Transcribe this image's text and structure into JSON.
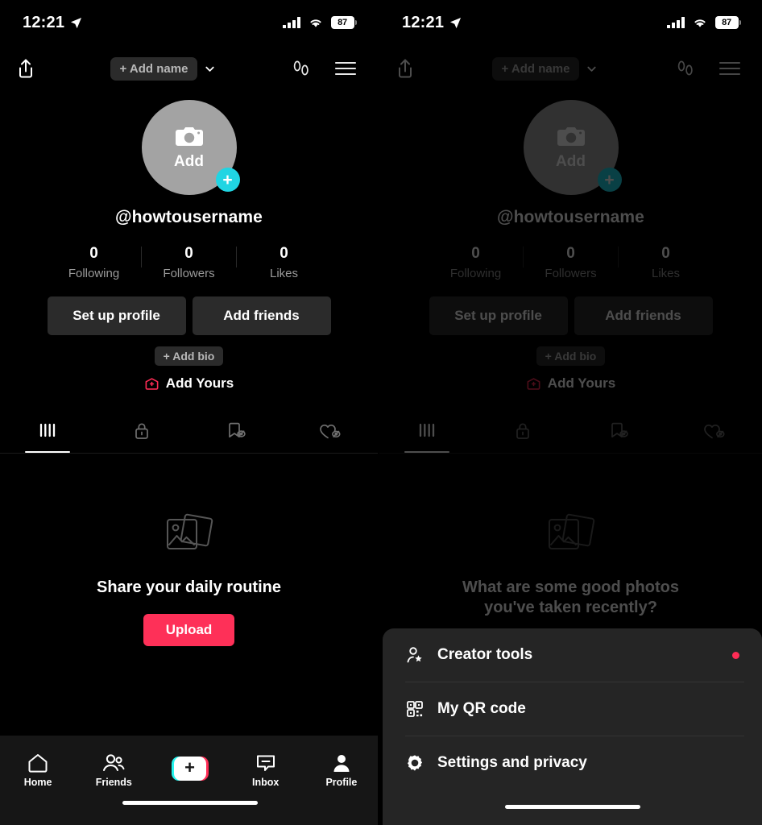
{
  "status_bar": {
    "time": "12:21",
    "battery_percent": "87",
    "location_icon": "location-arrow-icon",
    "signal_icon": "cellular-signal-icon",
    "wifi_icon": "wifi-icon"
  },
  "header": {
    "share_icon": "share-icon",
    "name_chip_label": "+ Add name",
    "chevron_icon": "chevron-down-icon",
    "footprints_icon": "footprints-icon",
    "menu_icon": "hamburger-menu-icon"
  },
  "profile": {
    "avatar_camera_icon": "camera-icon",
    "avatar_add_label": "Add",
    "avatar_plus_badge": "+",
    "avatar_badge_color": "#20d5e3",
    "username": "@howtousername",
    "stats": [
      {
        "value": "0",
        "label": "Following"
      },
      {
        "value": "0",
        "label": "Followers"
      },
      {
        "value": "0",
        "label": "Likes"
      }
    ],
    "actions": [
      {
        "label": "Set up profile",
        "name": "set-up-profile-button"
      },
      {
        "label": "Add friends",
        "name": "add-friends-button"
      }
    ],
    "bio_chip_label": "+ Add bio",
    "add_yours_label": "Add Yours",
    "add_yours_icon": "add-yours-sticker-icon",
    "add_yours_color": "#fe2c55"
  },
  "content_tabs": [
    {
      "name": "tab-posts",
      "icon": "grid-posts-icon",
      "active": true
    },
    {
      "name": "tab-private",
      "icon": "lock-icon",
      "active": false
    },
    {
      "name": "tab-saved",
      "icon": "bookmark-hidden-icon",
      "active": false
    },
    {
      "name": "tab-liked",
      "icon": "heart-hidden-icon",
      "active": false
    }
  ],
  "empty_state_left": {
    "icon": "photos-placeholder-icon",
    "text": "Share your daily routine",
    "upload_label": "Upload",
    "upload_color": "#fe3058"
  },
  "empty_state_right": {
    "icon": "photos-placeholder-icon",
    "text": "What are some good photos you've taken recently?"
  },
  "bottom_nav": [
    {
      "label": "Home",
      "icon": "home-icon",
      "name": "nav-home"
    },
    {
      "label": "Friends",
      "icon": "friends-icon",
      "name": "nav-friends"
    },
    {
      "label": "",
      "icon": "create-plus-icon",
      "name": "nav-create"
    },
    {
      "label": "Inbox",
      "icon": "inbox-icon",
      "name": "nav-inbox"
    },
    {
      "label": "Profile",
      "icon": "profile-person-icon",
      "name": "nav-profile"
    }
  ],
  "sheet_menu": [
    {
      "label": "Creator tools",
      "icon": "creator-tools-icon",
      "name": "sheet-item-creator-tools",
      "badge": true
    },
    {
      "label": "My QR code",
      "icon": "qr-code-icon",
      "name": "sheet-item-my-qr-code",
      "badge": false
    },
    {
      "label": "Settings and privacy",
      "icon": "gear-icon",
      "name": "sheet-item-settings-and-privacy",
      "badge": false
    }
  ]
}
